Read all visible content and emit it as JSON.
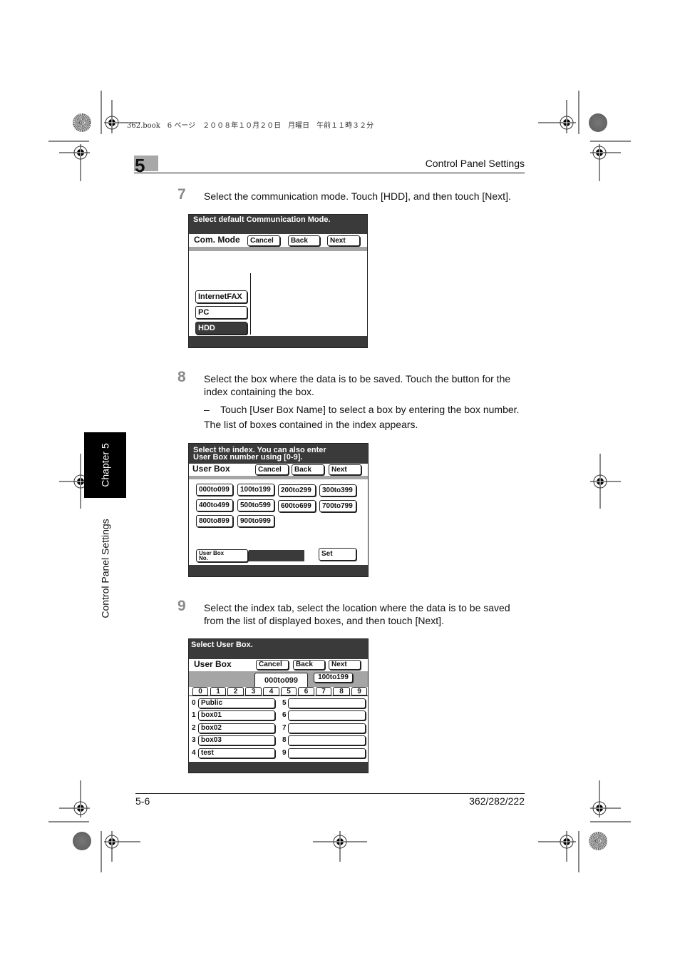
{
  "print_header": "362.book　6 ページ　２００８年１０月２０日　月曜日　午前１１時３２分",
  "header": {
    "chapter_number": "5",
    "section_title": "Control Panel Settings"
  },
  "side_tab": {
    "chapter_label": "Chapter 5",
    "section_label": "Control Panel Settings"
  },
  "steps": [
    {
      "number": "7",
      "text": "Select the communication mode. Touch [HDD], and then touch [Next]."
    },
    {
      "number": "8",
      "text": "Select the box where the data is to be saved. Touch the button for the index containing the box.",
      "bullet_dash": "–",
      "bullet": "Touch [User Box Name] to select a box by entering the box number.",
      "note": "The list of boxes contained in the index appears."
    },
    {
      "number": "9",
      "text": "Select the index tab, select the location where the data is to be saved from the list of displayed boxes, and then touch [Next]."
    }
  ],
  "screen1": {
    "message": "Select default Communication Mode.",
    "title": "Com. Mode",
    "cancel": "Cancel",
    "back": "Back",
    "next": "Next",
    "modes": [
      "InternetFAX",
      "PC",
      "HDD"
    ],
    "selected_mode": "HDD"
  },
  "screen2": {
    "message_line1": "Select the index. You can also enter",
    "message_line2": "User Box number using [0-9].",
    "title": "User Box",
    "cancel": "Cancel",
    "back": "Back",
    "next": "Next",
    "indexes": [
      "000to099",
      "100to199",
      "200to299",
      "300to399",
      "400to499",
      "500to599",
      "600to699",
      "700to799",
      "800to899",
      "900to999"
    ],
    "user_box_no_label_line1": "User Box",
    "user_box_no_label_line2": "No.",
    "user_box_no_value": "",
    "set": "Set"
  },
  "screen3": {
    "message": "Select User Box.",
    "title": "User Box",
    "cancel": "Cancel",
    "back": "Back",
    "next": "Next",
    "range_tabs": [
      "000to099",
      "100to199"
    ],
    "active_range": "000to099",
    "digit_tabs": [
      "0",
      "1",
      "2",
      "3",
      "4",
      "5",
      "6",
      "7",
      "8",
      "9"
    ],
    "active_digit": "0",
    "slots": [
      {
        "num": "0",
        "name": "Public"
      },
      {
        "num": "1",
        "name": "box01"
      },
      {
        "num": "2",
        "name": "box02"
      },
      {
        "num": "3",
        "name": "box03"
      },
      {
        "num": "4",
        "name": "test"
      },
      {
        "num": "5",
        "name": ""
      },
      {
        "num": "6",
        "name": ""
      },
      {
        "num": "7",
        "name": ""
      },
      {
        "num": "8",
        "name": ""
      },
      {
        "num": "9",
        "name": ""
      }
    ]
  },
  "footer": {
    "page_number": "5-6",
    "models": "362/282/222"
  }
}
